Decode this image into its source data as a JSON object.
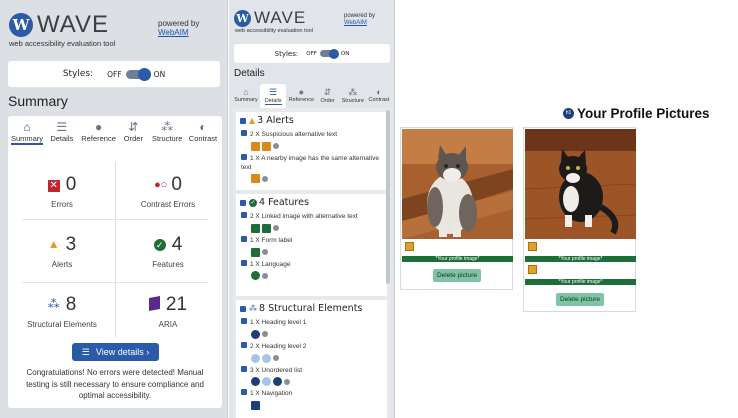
{
  "wave_logo_text": "WAVE",
  "tagline": "web accessibility evaluation tool",
  "powered_by": "powered by",
  "webaim_link": "WebAIM",
  "styles": {
    "label": "Styles:",
    "off": "OFF",
    "on": "ON"
  },
  "summary": {
    "heading": "Summary",
    "tabs": [
      "Summary",
      "Details",
      "Reference",
      "Order",
      "Structure",
      "Contrast"
    ],
    "stats": [
      {
        "count": "0",
        "label": "Errors"
      },
      {
        "count": "0",
        "label": "Contrast Errors"
      },
      {
        "count": "3",
        "label": "Alerts"
      },
      {
        "count": "4",
        "label": "Features"
      },
      {
        "count": "8",
        "label": "Structural Elements"
      },
      {
        "count": "21",
        "label": "ARIA"
      }
    ],
    "view_details": "View details ›",
    "message": "Congratulations! No errors were detected! Manual testing is still necessary to ensure compliance and optimal accessibility."
  },
  "details": {
    "heading": "Details",
    "tabs": [
      "Summary",
      "Details",
      "Reference",
      "Order",
      "Structure",
      "Contrast"
    ],
    "sections": [
      {
        "title": "3 Alerts",
        "items": [
          "2 X Suspicious alternative text",
          "1 X A nearby image has the same alternative text"
        ]
      },
      {
        "title": "4 Features",
        "items": [
          "2 X Linked image with alternative text",
          "1 X Form label",
          "1 X Language"
        ]
      },
      {
        "title": "8 Structural Elements",
        "items": [
          "1 X Heading level 1",
          "2 X Heading level 2",
          "3 X Unordered list",
          "1 X Navigation"
        ]
      }
    ]
  },
  "profile": {
    "title": "Your Profile Pictures",
    "badge": "h1",
    "pictures": [
      {
        "caption": "*Your profile image*",
        "button": "Delete picture"
      },
      {
        "caption": "*Your profile image*",
        "button": "Delete picture"
      }
    ]
  },
  "colors": {
    "accent": "#2a5aa8",
    "success": "#1f6e3a",
    "error": "#c0262d",
    "alert": "#e69b1c"
  }
}
